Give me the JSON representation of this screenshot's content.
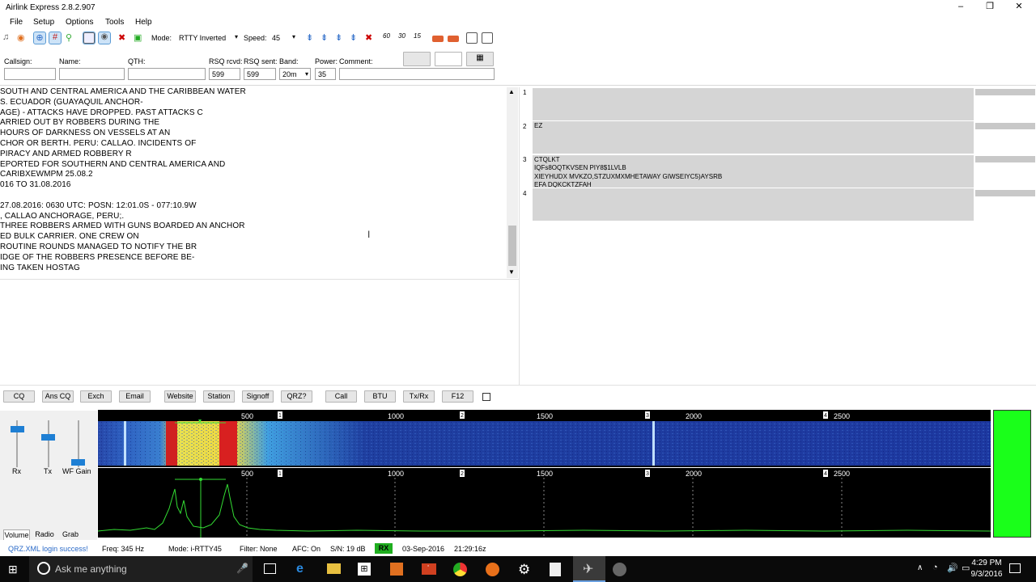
{
  "window": {
    "title": "Airlink Express 2.8.2.907",
    "min": "–",
    "max": "❐",
    "close": "✕"
  },
  "menu": [
    "File",
    "Setup",
    "Options",
    "Tools",
    "Help"
  ],
  "toolbar": {
    "mode_label": "Mode:",
    "mode_value": "RTTY Inverted",
    "speed_label": "Speed:",
    "speed_value": "45"
  },
  "log": {
    "callsign_label": "Callsign:",
    "name_label": "Name:",
    "qth_label": "QTH:",
    "rsq_rcvd_label": "RSQ rcvd:",
    "rsq_sent_label": "RSQ sent:",
    "band_label": "Band:",
    "power_label": "Power:",
    "comment_label": "Comment:",
    "rsq_rcvd": "599",
    "rsq_sent": "599",
    "band": "20m",
    "power": "35"
  },
  "rx_text": "SOUTH AND CENTRAL AMERICA AND THE CARIBBEAN WATER\nS. ECUADOR (GUAYAQUIL ANCHOR-\nAGE) - ATTACKS HAVE DROPPED. PAST ATTACKS C\nARRIED OUT BY ROBBERS DURING THE\nHOURS OF DARKNESS ON VESSELS AT AN\nCHOR OR BERTH. PERU: CALLAO. INCIDENTS OF\nPIRACY AND ARMED ROBBERY R\nEPORTED FOR SOUTHERN AND CENTRAL AMERICA AND\nCARIBXEWMPM 25.08.2\n016 TO 31.08.2016\n\n27.08.2016: 0630 UTC: POSN: 12:01.0S - 077:10.9W\n, CALLAO ANCHORAGE, PERU;.\nTHREE ROBBERS ARMED WITH GUNS BOARDED AN ANCHOR\nED BULK CARRIER. ONE CREW ON\nROUTINE ROUNDS MANAGED TO NOTIFY THE BR\nIDGE OF THE ROBBERS PRESENCE BEFORE BE-\nING TAKEN HOSTAG",
  "slots": [
    {
      "num": "1",
      "text": ""
    },
    {
      "num": "2",
      "text": "EZ"
    },
    {
      "num": "3",
      "text": "CTQLKT\nIQFs8OQTKVSEN PIY8$1LVLB\nXIEYHUDX MVKZO,STZUXMXMHETAWAY GIWSEIYC5)AYSRB\nEFA DQKCKTZFAH"
    },
    {
      "num": "4",
      "text": ""
    }
  ],
  "macros": [
    "CQ",
    "Ans CQ",
    "Exch",
    "Email",
    "Website",
    "Station",
    "Signoff",
    "QRZ?",
    "Call",
    "BTU",
    "Tx/Rx",
    "F12"
  ],
  "sliders": {
    "rx": "Rx",
    "tx": "Tx",
    "wf": "WF Gain"
  },
  "tabs": [
    "Volume",
    "Radio",
    "Grab"
  ],
  "freq_ticks": [
    "500",
    "1000",
    "1500",
    "2000",
    "2500"
  ],
  "markers": [
    "1",
    "2",
    "3",
    "4"
  ],
  "status": {
    "login": "QRZ.XML login success!",
    "freq": "Freq: 345 Hz",
    "mode": "Mode: i-RTTY45",
    "filter": "Filter: None",
    "afc": "AFC: On",
    "sn": "S/N: 19 dB",
    "rx": "RX",
    "date": "03-Sep-2016",
    "time": "21:29:16z"
  },
  "taskbar": {
    "search": "Ask me anything",
    "time": "4:29 PM",
    "date": "9/3/2016"
  },
  "colors": {
    "meter": "#1aff1a",
    "rx_badge": "#1fae1f",
    "trace": "#33dd33"
  }
}
